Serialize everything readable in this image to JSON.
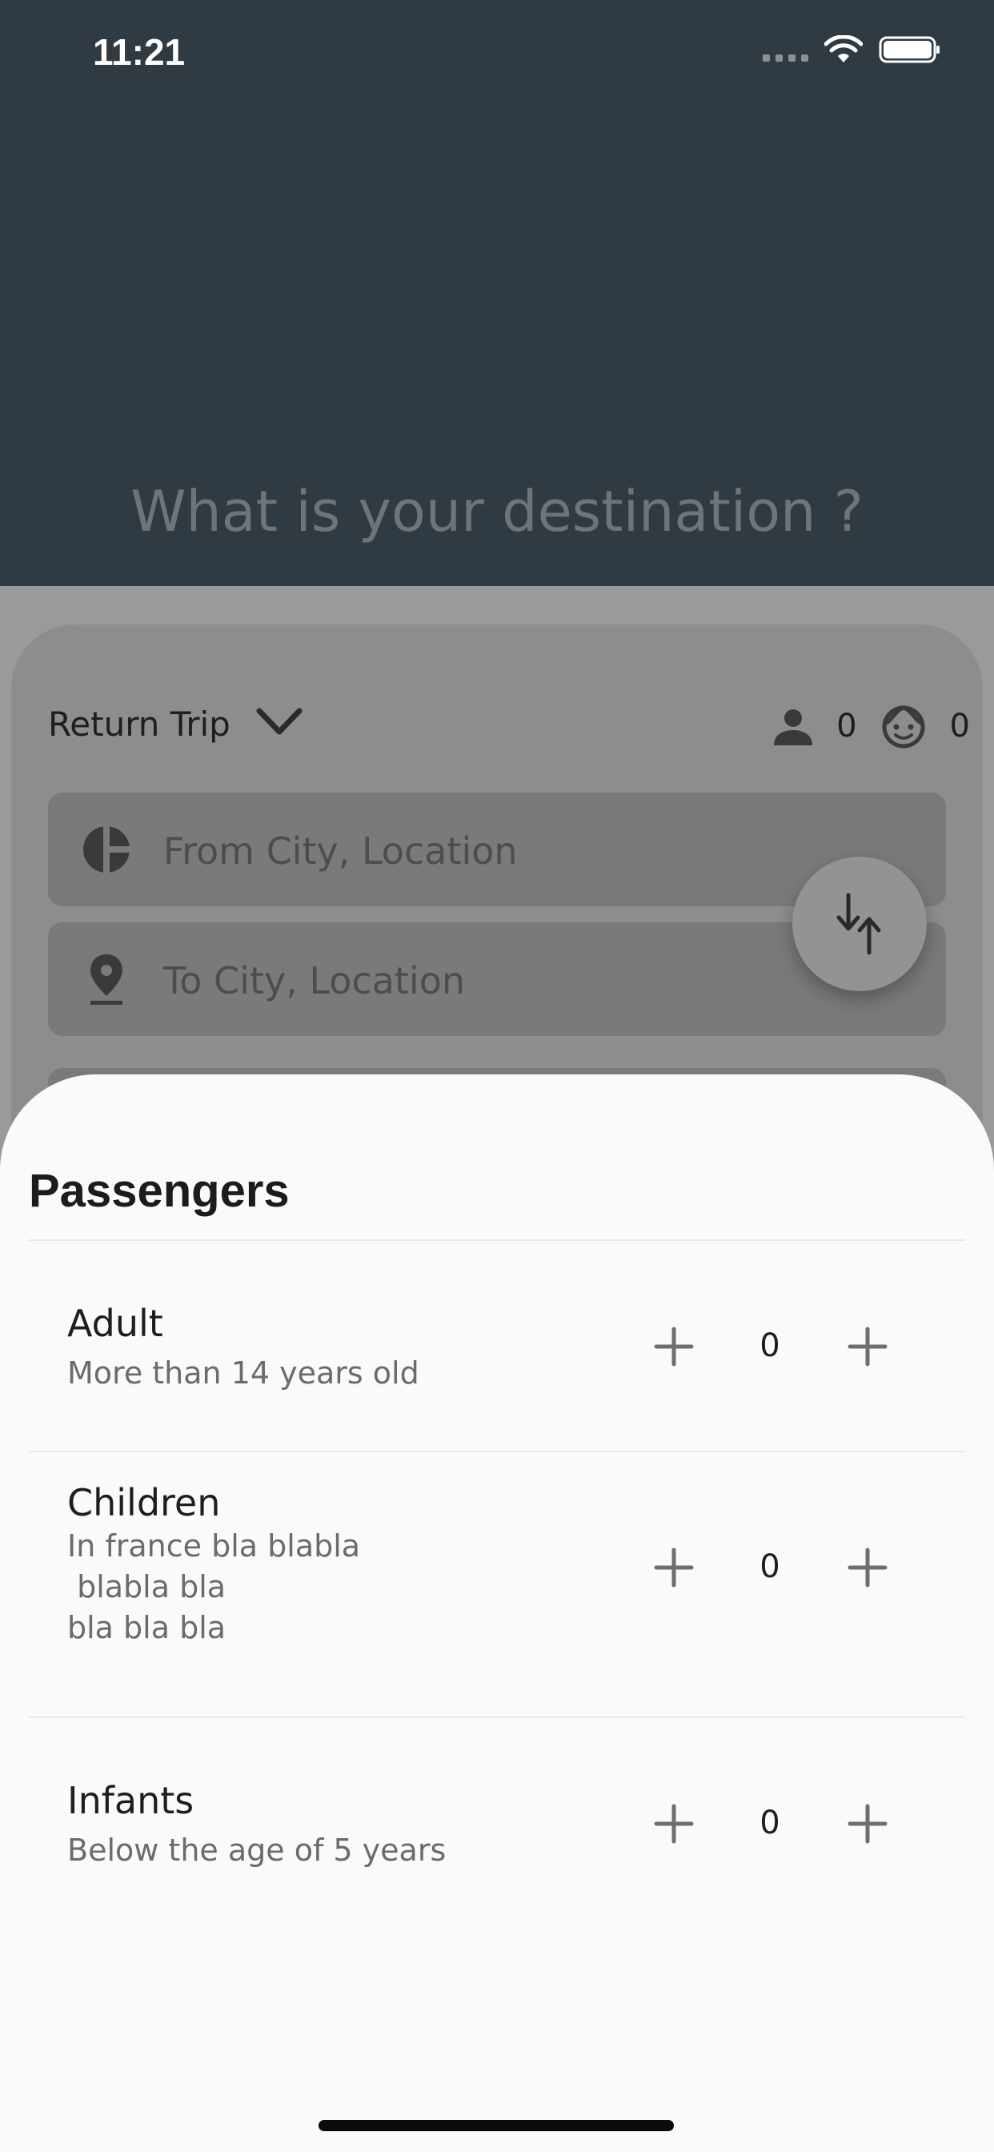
{
  "status_bar": {
    "time": "11:21"
  },
  "header": {
    "title": "What is your destination ?"
  },
  "search_card": {
    "trip_type": "Return Trip",
    "adults_count": "0",
    "children_count": "0",
    "from_placeholder": "From City, Location",
    "to_placeholder": "To City, Location"
  },
  "sheet": {
    "title": "Passengers",
    "rows": [
      {
        "title": "Adult",
        "subtitle": "More than 14 years old",
        "value": "0"
      },
      {
        "title": "Children",
        "subtitle": "In france bla blabla\n blabla bla\nbla bla bla",
        "value": "0"
      },
      {
        "title": "Infants",
        "subtitle": "Below the age of 5 years",
        "value": "0"
      }
    ]
  },
  "icons": {
    "signal": "signal-dots-icon",
    "wifi": "wifi-icon",
    "battery": "battery-icon",
    "chevron": "chevron-down-icon",
    "person": "person-icon",
    "child": "child-face-icon",
    "from": "location-disc-icon",
    "to": "map-pin-icon",
    "swap": "swap-arrows-icon",
    "stepper": "plus-icon"
  },
  "colors": {
    "header_bg": "#2f3a42",
    "overlay": "#9a9a9a",
    "sheet_bg": "#fafafa",
    "text_primary": "#1e1e1e",
    "text_secondary": "#6b6b6b"
  }
}
